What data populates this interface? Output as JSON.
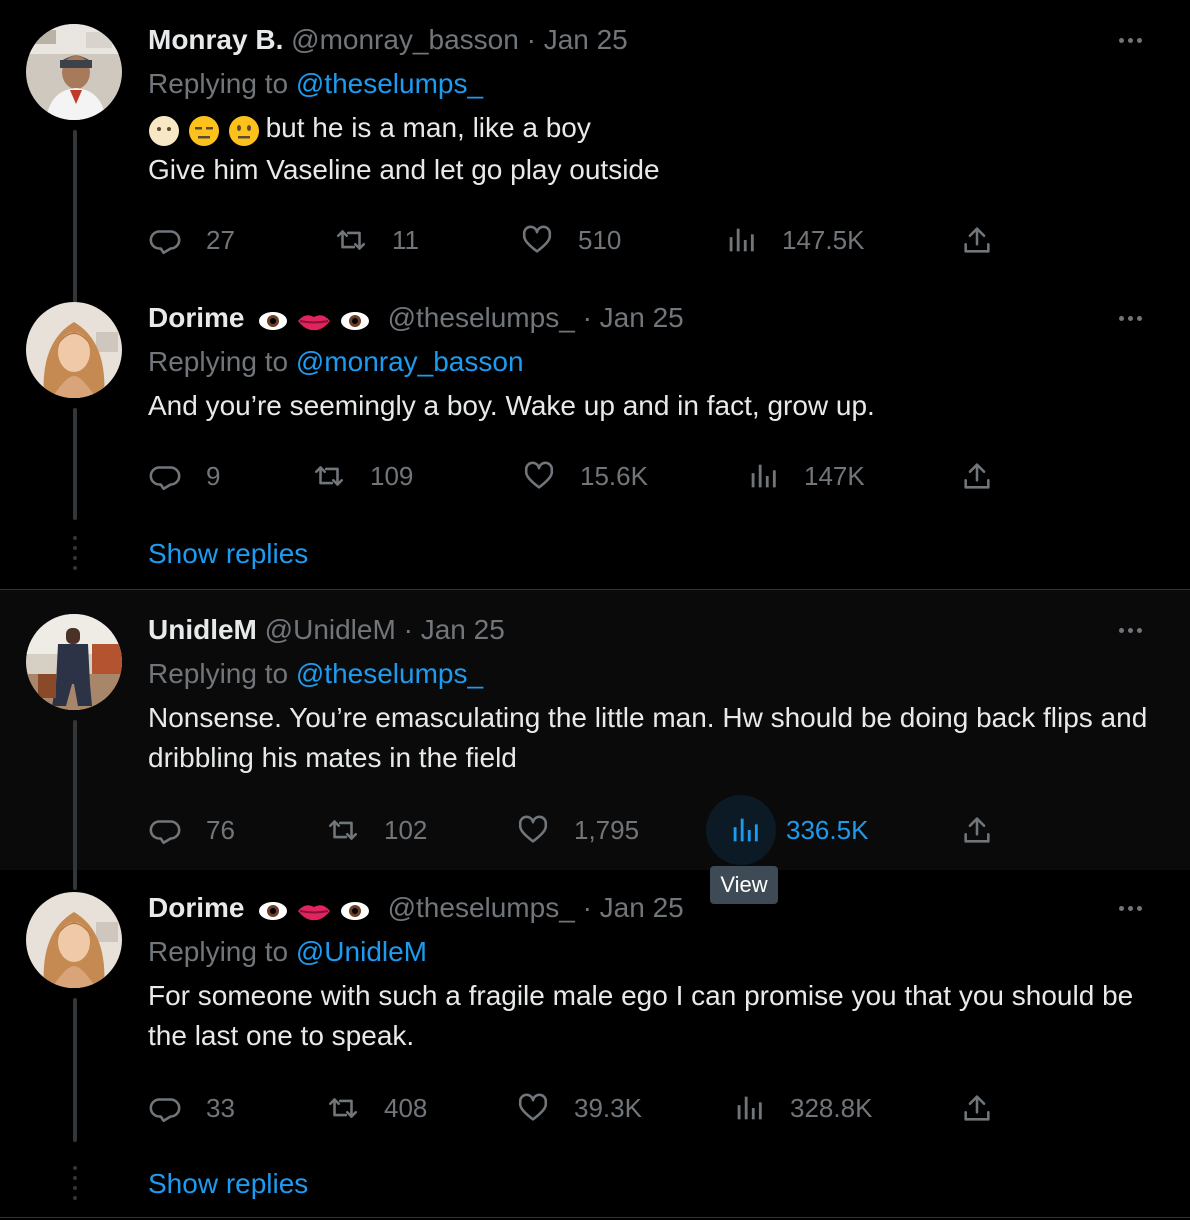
{
  "colors": {
    "background": "#000000",
    "text": "#e7e9ea",
    "muted": "#71767b",
    "accent": "#1d9bf0",
    "divider": "#2f3336"
  },
  "tweets": [
    {
      "name": "Monray B.",
      "handle": "@monray_basson",
      "dot": "·",
      "date": "Jan 25",
      "replying_prefix": "Replying to ",
      "replying_to": "@theselumps_",
      "lead_emoji_text": "but he is a man, like a boy",
      "text_line2": "Give him Vaseline and let go play outside",
      "replies": "27",
      "retweets": "11",
      "likes": "510",
      "views": "147.5K",
      "icons": {
        "reply": "reply-icon",
        "retweet": "retweet-icon",
        "like": "heart-icon",
        "views": "views-icon",
        "share": "share-icon"
      }
    },
    {
      "name": "Dorime",
      "handle": "@theselumps_",
      "dot": "·",
      "date": "Jan 25",
      "replying_prefix": "Replying to ",
      "replying_to": "@monray_basson",
      "text": "And you’re seemingly a boy. Wake up and in fact, grow up.",
      "replies": "9",
      "retweets": "109",
      "likes": "15.6K",
      "views": "147K",
      "show_replies": "Show replies"
    },
    {
      "name": "UnidleM",
      "handle": "@UnidleM",
      "dot": "·",
      "date": "Jan 25",
      "replying_prefix": "Replying to ",
      "replying_to": "@theselumps_",
      "text": "Nonsense. You’re emasculating the little man. Hw should be doing back flips and dribbling his mates in the field",
      "replies": "76",
      "retweets": "102",
      "likes": "1,795",
      "views": "336.5K",
      "tooltip": "View"
    },
    {
      "name": "Dorime",
      "handle": "@theselumps_",
      "dot": "·",
      "date": "Jan 25",
      "replying_prefix": "Replying to ",
      "replying_to": "@UnidleM",
      "text": "For someone with such a fragile male ego I can promise you that you should be the last one to speak.",
      "replies": "33",
      "retweets": "408",
      "likes": "39.3K",
      "views": "328.8K",
      "show_replies": "Show replies"
    }
  ]
}
